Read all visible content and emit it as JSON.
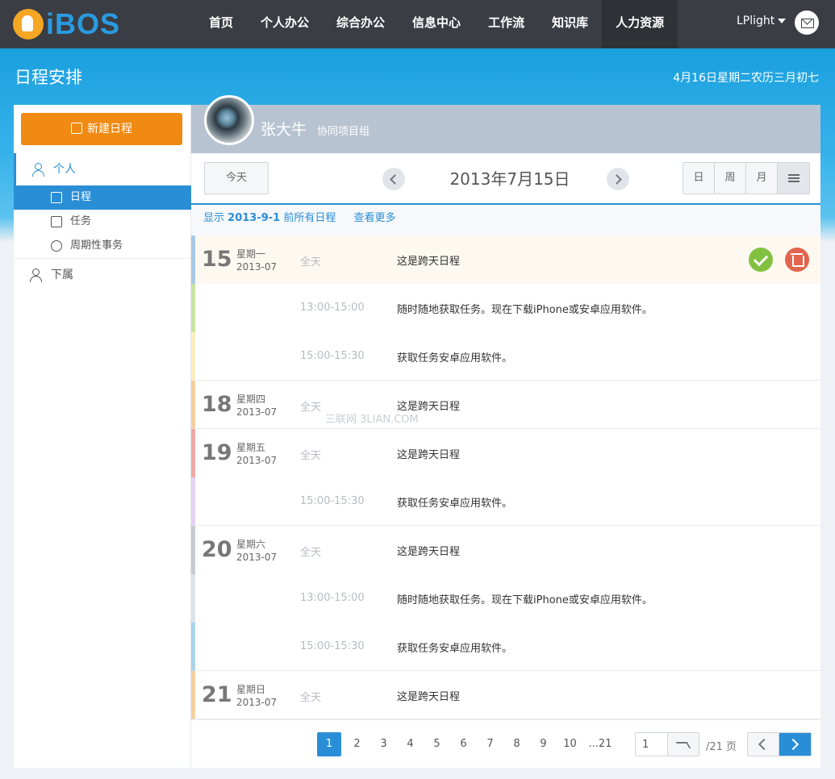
{
  "topbar": {
    "logo_text": "iBOS",
    "nav": [
      {
        "label": "首页"
      },
      {
        "label": "个人办公"
      },
      {
        "label": "综合办公"
      },
      {
        "label": "信息中心"
      },
      {
        "label": "工作流"
      },
      {
        "label": "知识库"
      },
      {
        "label": "人力资源",
        "active": true
      }
    ],
    "user_name": "LPlight",
    "mail_icon": "mail-icon"
  },
  "banner": {
    "title": "日程安排",
    "date": "4月16日星期二农历三月初七"
  },
  "sidebar": {
    "new_button": "新建日程",
    "personal_label": "个人",
    "items": [
      {
        "label": "日程",
        "icon": "calendar-icon",
        "active": true
      },
      {
        "label": "任务",
        "icon": "checkbox-icon"
      },
      {
        "label": "周期性事务",
        "icon": "clock-icon"
      }
    ],
    "subordinate_label": "下属"
  },
  "profile": {
    "name": "张大牛",
    "group": "协同项目组"
  },
  "toolbar": {
    "today_label": "今天",
    "current_date": "2013年7月15日",
    "views": [
      "日",
      "周",
      "月"
    ]
  },
  "filter": {
    "prefix": "显示",
    "date": "2013-9-1",
    "suffix": "前所有日程",
    "more": "查看更多"
  },
  "rows": [
    {
      "day": "15",
      "week": "星期一",
      "ym": "2013-07",
      "time": "全天",
      "title": "这是跨天日程",
      "color": "#a7c9e6",
      "highlight": true
    },
    {
      "day": "",
      "week": "",
      "ym": "",
      "time": "13:00-15:00",
      "title": "随时随地获取任务。现在下载iPhone或安卓应用软件。",
      "color": "#c7e4a0"
    },
    {
      "day": "",
      "week": "",
      "ym": "",
      "time": "15:00-15:30",
      "title": "获取任务安卓应用软件。",
      "color": "#fbeec0"
    },
    {
      "day": "18",
      "week": "星期四",
      "ym": "2013-07",
      "time": "全天",
      "title": "这是跨天日程",
      "color": "#f6cf9f"
    },
    {
      "day": "19",
      "week": "星期五",
      "ym": "2013-07",
      "time": "全天",
      "title": "这是跨天日程",
      "color": "#f0a8a5"
    },
    {
      "day": "",
      "week": "",
      "ym": "",
      "time": "15:00-15:30",
      "title": "获取任务安卓应用软件。",
      "color": "#e5d2f5"
    },
    {
      "day": "20",
      "week": "星期六",
      "ym": "2013-07",
      "time": "全天",
      "title": "这是跨天日程",
      "color": "#c7cbd0"
    },
    {
      "day": "",
      "week": "",
      "ym": "",
      "time": "13:00-15:00",
      "title": "随时随地获取任务。现在下载iPhone或安卓应用软件。",
      "color": "#dbe3ec"
    },
    {
      "day": "",
      "week": "",
      "ym": "",
      "time": "15:00-15:30",
      "title": "获取任务安卓应用软件。",
      "color": "#a9d3ec"
    },
    {
      "day": "21",
      "week": "星期日",
      "ym": "2013-07",
      "time": "全天",
      "title": "这是跨天日程",
      "color": "#f6cf9f"
    }
  ],
  "watermark": "三联网 3LIAN.COM",
  "pager": {
    "pages": [
      "1",
      "2",
      "3",
      "4",
      "5",
      "6",
      "7",
      "8",
      "9",
      "10",
      "...21"
    ],
    "current": "1",
    "jump_value": "1",
    "total": "/21 页"
  }
}
